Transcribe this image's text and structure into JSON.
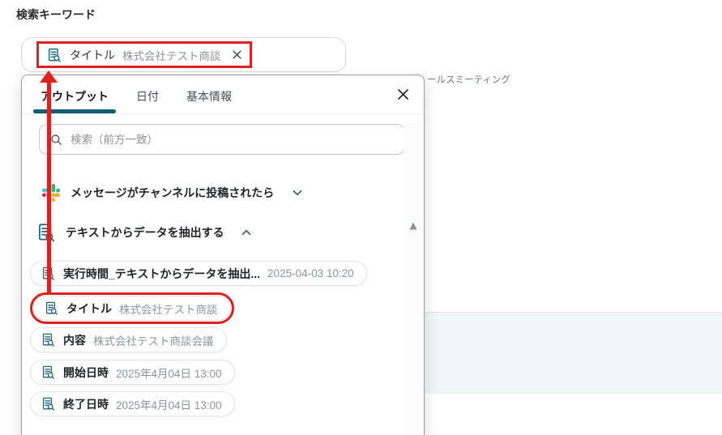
{
  "page": {
    "keyword_label": "検索キーワード",
    "background_partial_text": "ールスミーティング"
  },
  "search_field": {
    "chip": {
      "label": "タイトル",
      "value": "株式会社テスト商談",
      "close_icon": "x-icon"
    }
  },
  "panel": {
    "tabs": [
      {
        "label": "アウトプット",
        "active": true
      },
      {
        "label": "日付",
        "active": false
      },
      {
        "label": "基本情報",
        "active": false
      }
    ],
    "close_icon": "x-icon",
    "search": {
      "placeholder": "検索（前方一致）",
      "value": "",
      "icon": "search-icon"
    },
    "trigger_row": {
      "icon": "slack-icon",
      "label": "メッセージがチャンネルに投稿されたら",
      "state": "collapsed"
    },
    "extract_row": {
      "icon": "extract-data-icon",
      "label": "テキストからデータを抽出する",
      "state": "expanded"
    },
    "items": [
      {
        "label": "実行時間_テキストからデータを抽出...",
        "value": "2025-04-03 10:20",
        "highlighted": false
      },
      {
        "label": "タイトル",
        "value": "株式会社テスト商談",
        "highlighted": true
      },
      {
        "label": "内容",
        "value": "株式会社テスト商談会議",
        "highlighted": false
      },
      {
        "label": "開始日時",
        "value": "2025年4月04日 13:00",
        "highlighted": false
      },
      {
        "label": "終了日時",
        "value": "2025年4月04日 13:00",
        "highlighted": false
      }
    ],
    "scroll_up_glyph": "▲"
  },
  "annotation": {
    "color": "#e01f1f",
    "meaning": "arrow linking selected output item to search keyword chip"
  },
  "colors": {
    "accent_teal": "#0e6077",
    "annotation_red": "#e01f1f",
    "highlight_band": "#eff8f6",
    "slack_blue": "#36C5F0",
    "slack_green": "#2EB67D",
    "slack_yellow": "#ECB22E",
    "slack_red": "#E01E5A"
  }
}
